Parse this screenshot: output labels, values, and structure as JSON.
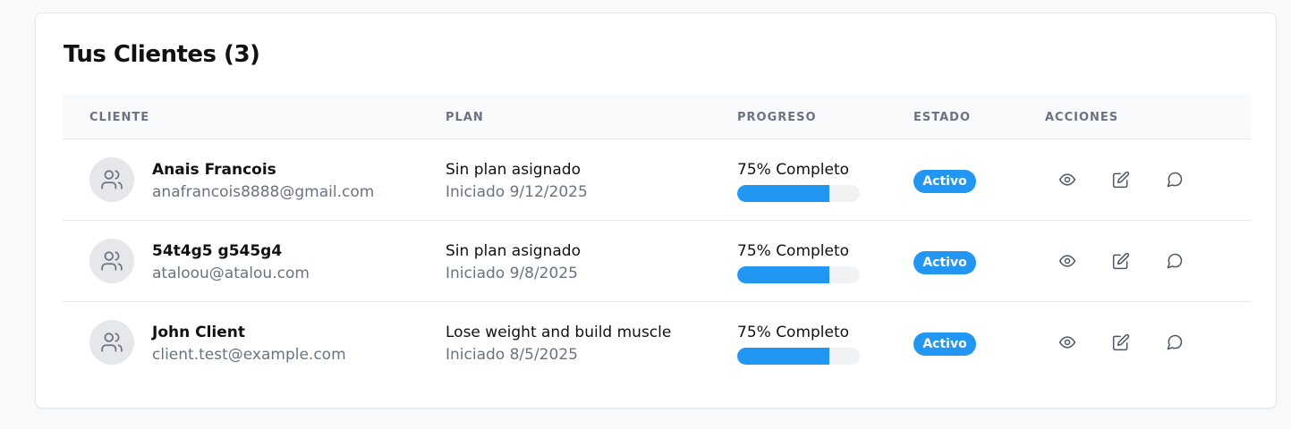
{
  "title": "Tus Clientes (3)",
  "columns": {
    "client": "CLIENTE",
    "plan": "PLAN",
    "progress": "PROGRESO",
    "status": "ESTADO",
    "actions": "ACCIONES"
  },
  "colors": {
    "accent": "#2196f3",
    "muted_text": "#6b7280",
    "border": "#e5e7eb"
  },
  "clients": [
    {
      "name": "Anais Francois",
      "email": "anafrancois8888@gmail.com",
      "plan": "Sin plan asignado",
      "started": "Iniciado 9/12/2025",
      "progress_label": "75% Completo",
      "progress": 0.75,
      "status": "Activo",
      "avatar_icon": "users-icon",
      "action_icons": [
        "eye-icon",
        "edit-icon",
        "message-icon"
      ]
    },
    {
      "name": "54t4g5 g545g4",
      "email": "ataloou@atalou.com",
      "plan": "Sin plan asignado",
      "started": "Iniciado 9/8/2025",
      "progress_label": "75% Completo",
      "progress": 0.75,
      "status": "Activo",
      "avatar_icon": "users-icon",
      "action_icons": [
        "eye-icon",
        "edit-icon",
        "message-icon"
      ]
    },
    {
      "name": "John Client",
      "email": "client.test@example.com",
      "plan": "Lose weight and build muscle",
      "started": "Iniciado 8/5/2025",
      "progress_label": "75% Completo",
      "progress": 0.75,
      "status": "Activo",
      "avatar_icon": "users-icon",
      "action_icons": [
        "eye-icon",
        "edit-icon",
        "message-icon"
      ]
    }
  ]
}
